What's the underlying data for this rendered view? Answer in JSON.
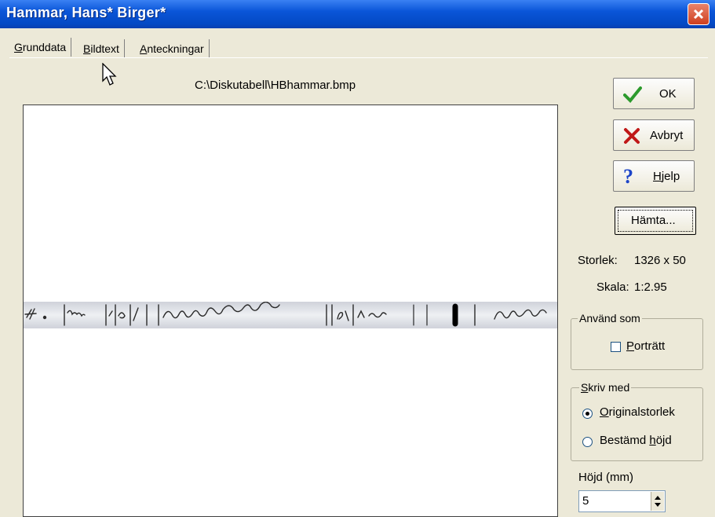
{
  "window": {
    "title": "Hammar, Hans* Birger*"
  },
  "tabs": [
    {
      "label_first": "G",
      "label_rest": "runddata"
    },
    {
      "label_first": "B",
      "label_rest": "ildtext"
    },
    {
      "label_first": "A",
      "label_rest": "nteckningar"
    }
  ],
  "image": {
    "path": "C:\\Diskutabell\\HBhammar.bmp"
  },
  "buttons": {
    "ok": "OK",
    "cancel": "Avbryt",
    "help_first": "H",
    "help_rest": "jelp",
    "fetch": "Hämta..."
  },
  "info": {
    "size_label": "Storlek:",
    "size_value": "1326 x 50",
    "scale_label": "Skala:",
    "scale_value": "1:2.95"
  },
  "use_as": {
    "group_label": "Använd som",
    "portrait_first": "P",
    "portrait_rest": "orträtt",
    "portrait_checked": false
  },
  "print_with": {
    "group_label_first": "S",
    "group_label_rest": "kriv med",
    "original_first": "O",
    "original_rest": "riginalstorlek",
    "fixed_prefix": "Bestämd ",
    "fixed_ul": "h",
    "fixed_suffix": "öjd",
    "selected": "original"
  },
  "height": {
    "label_prefix": "Hö",
    "label_ul": "j",
    "label_suffix": "d (mm)",
    "value": "5"
  },
  "colors": {
    "title_bar": "#0a55d8",
    "dialog_bg": "#ece9d8",
    "ok_check": "#2c9a2c",
    "cancel_x": "#c01818",
    "help_q": "#1c44c8"
  }
}
